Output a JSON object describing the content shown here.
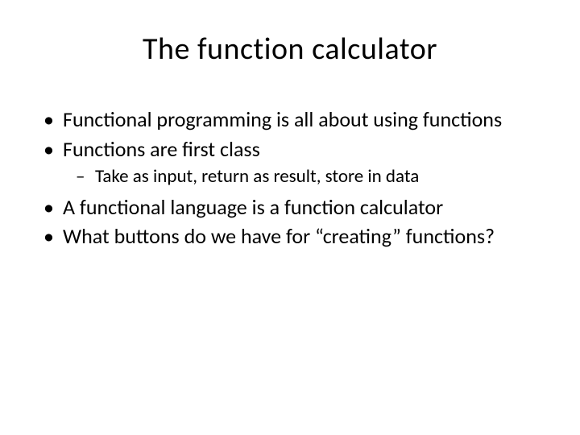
{
  "slide": {
    "title": "The function calculator",
    "bullets": {
      "b1": "Functional programming is all about using functions",
      "b2": "Functions are first class",
      "b2_sub1": "Take as input, return as result, store in data",
      "b3": "A functional language is a function calculator",
      "b4": "What buttons do we have for “creating” functions?"
    }
  }
}
